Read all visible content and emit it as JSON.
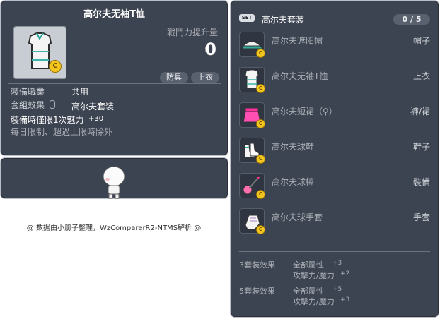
{
  "item_id": "01042252",
  "tooltip": {
    "title": "高尔夫无袖T恤",
    "combat_label": "戰鬥力提升量",
    "combat_value": "0",
    "tags": [
      "防具",
      "上衣"
    ],
    "job_label": "裝備職業",
    "job_value": "共用",
    "set_label": "套組效果",
    "set_value": "高尔夫套装",
    "time_effect_label": "裝備時僅限1次魅力",
    "time_effect_value": "+30",
    "note": "每日限制、超過上限時除外"
  },
  "footer_note": "@ 数据由小册子整理，WzComparerR2-NTMS解析 @",
  "set_panel": {
    "badge": "SET",
    "title": "高尔夫套装",
    "progress": "0 / 5",
    "items": [
      {
        "name": "高尔夫遮阳帽",
        "slot": "帽子",
        "icon": "visor-icon"
      },
      {
        "name": "高尔夫无袖T恤",
        "slot": "上衣",
        "icon": "shirt-icon"
      },
      {
        "name": "高尔夫短裙（♀）",
        "slot": "褲/裙",
        "icon": "skirt-icon"
      },
      {
        "name": "高尔夫球鞋",
        "slot": "鞋子",
        "icon": "shoes-icon"
      },
      {
        "name": "高尔夫球棒",
        "slot": "裝備",
        "icon": "club-icon"
      },
      {
        "name": "高尔夫球手套",
        "slot": "手套",
        "icon": "glove-icon"
      }
    ],
    "effects": [
      {
        "label": "3套裝效果",
        "lines": [
          {
            "text": "全部屬性",
            "value": "+3"
          },
          {
            "text": "攻擊力/魔力",
            "value": "+2"
          }
        ]
      },
      {
        "label": "5套裝效果",
        "lines": [
          {
            "text": "全部屬性",
            "value": "+5"
          },
          {
            "text": "攻擊力/魔力",
            "value": "+3"
          }
        ]
      }
    ]
  },
  "colors": {
    "panel": "#3d4451",
    "border": "#b9bec7",
    "accent": "#f2c51f"
  }
}
